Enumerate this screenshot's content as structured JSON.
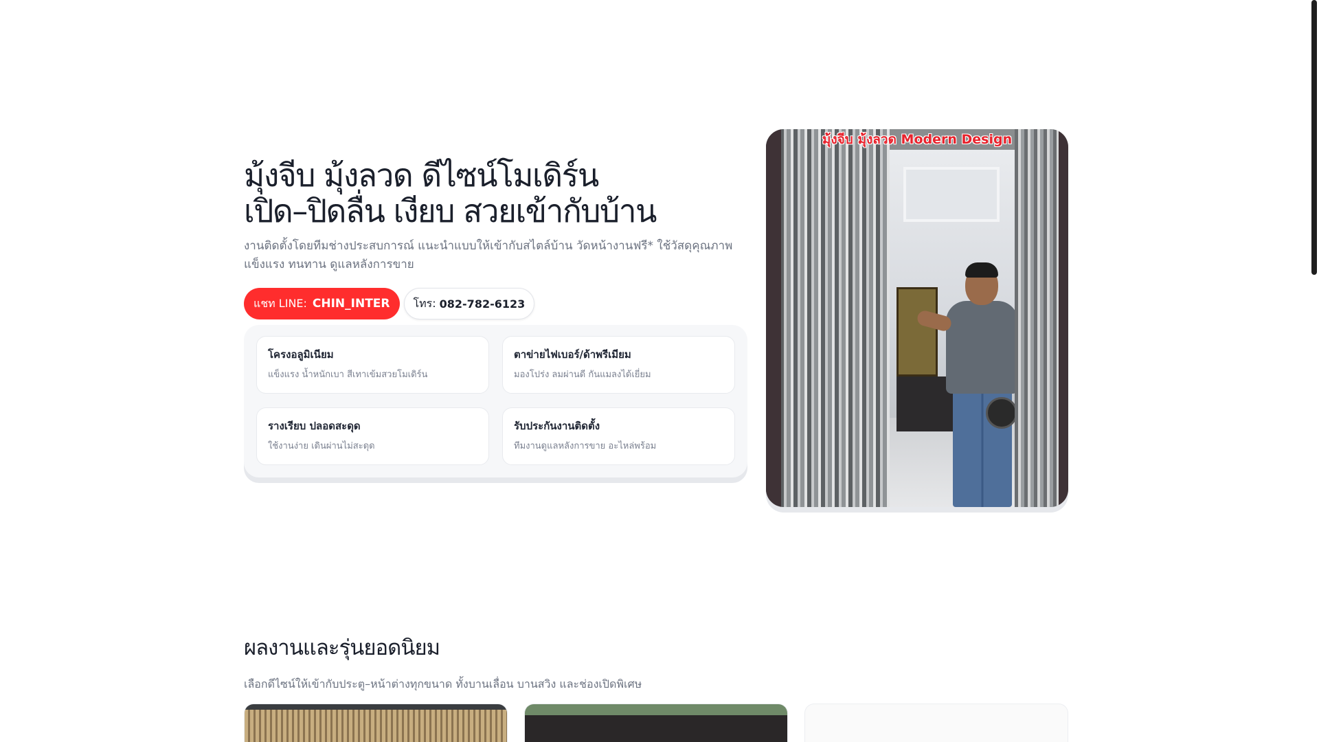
{
  "hero": {
    "title_line1": "มุ้งจีบ มุ้งลวด ดีไซน์โมเดิร์น",
    "title_line2": "เปิด–ปิดลื่น เงียบ สวยเข้ากับบ้าน",
    "subtitle": "งานติดตั้งโดยทีมช่างประสบการณ์ แนะนำแบบให้เข้ากับสไตล์บ้าน วัดหน้างานฟรี* ใช้วัสดุคุณภาพ แข็งแรง ทนทาน ดูแลหลังการขาย",
    "cta_line_prefix": "แชท LINE:",
    "cta_line_id": "CHIN_INTER",
    "cta_tel_prefix": "โทร:",
    "cta_tel_number": "082-782-6123",
    "media_caption": "มุ้งจีบ มุ้งลวด Modern Design"
  },
  "features": [
    {
      "title": "โครงอลูมิเนียม",
      "desc": "แข็งแรง น้ำหนักเบา สีเทาเข้มสวยโมเดิร์น"
    },
    {
      "title": "ตาข่ายไฟเบอร์/ด้าพรีเมียม",
      "desc": "มองโปร่ง ลมผ่านดี กันแมลงได้เยี่ยม"
    },
    {
      "title": "รางเรียบ ปลอดสะดุด",
      "desc": "ใช้งานง่าย เดินผ่านไม่สะดุด"
    },
    {
      "title": "รับประกันงานติดตั้ง",
      "desc": "ทีมงานดูแลหลังการขาย อะไหล่พร้อม"
    }
  ],
  "works": {
    "title": "ผลงานและรุ่นยอดนิยม",
    "subtitle": "เลือกดีไซน์ให้เข้ากับประตู–หน้าต่างทุกขนาด ทั้งบานเลื่อน บานสวิง และช่องเปิดพิเศษ"
  },
  "colors": {
    "accent": "#ff2d2d",
    "text_dark": "#1a1f2b",
    "text_muted": "#6b7280"
  }
}
